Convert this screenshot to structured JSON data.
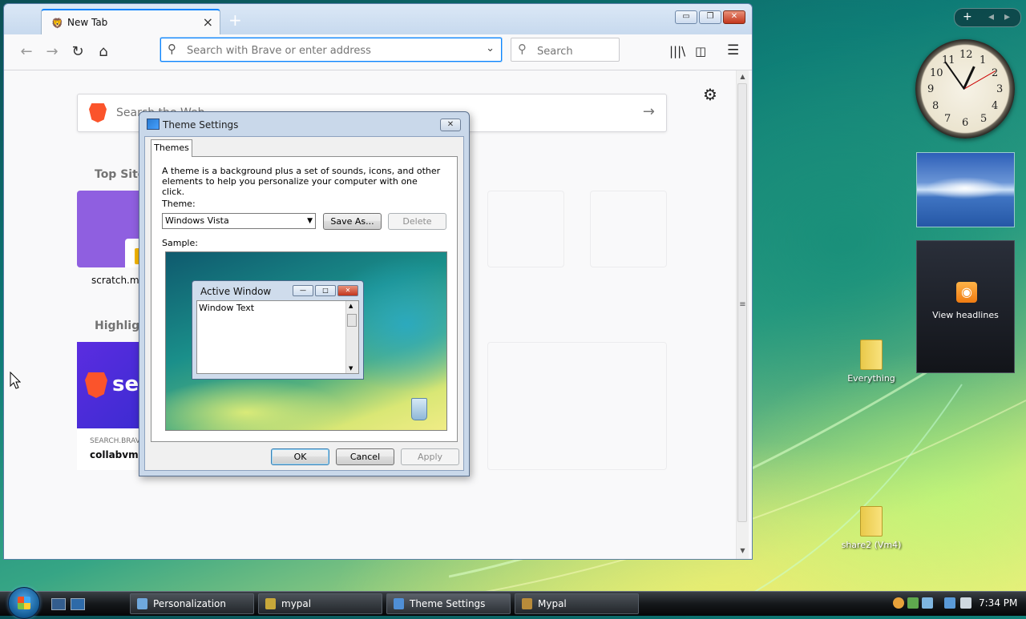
{
  "browser": {
    "tab": {
      "title": "New Tab",
      "close": "×"
    },
    "new_tab": "+",
    "window_controls": {
      "minimize": "▭",
      "maximize": "❐",
      "close": "✕"
    },
    "nav": {
      "back": "←",
      "forward": "→",
      "reload": "↻",
      "home": "⌂"
    },
    "urlbar": {
      "placeholder": "Search with Brave or enter address",
      "dropdown": "⌄"
    },
    "searchbox": {
      "placeholder": "Search"
    },
    "toolbar_icons": {
      "library": "|||\\",
      "sidebar": "◫",
      "menu": "☰"
    },
    "content": {
      "settings_icon": "⚙",
      "web_search": {
        "placeholder": "Search the Web",
        "go": "→"
      },
      "top_sites_heading": "Top Sites",
      "top_site_label": "scratch.mit",
      "highlights_heading": "Highlight",
      "highlight_card": {
        "brand": "se",
        "source": "SEARCH.BRAV",
        "title": "collabvm -"
      }
    },
    "scroll": {
      "up": "▲",
      "down": "▼",
      "grip": "≡"
    }
  },
  "dialog": {
    "title": "Theme Settings",
    "close": "✕",
    "tab": "Themes",
    "description": "A theme is a background plus a set of sounds, icons, and other elements to help you personalize your computer with one click.",
    "theme_label": "Theme:",
    "theme_value": "Windows Vista",
    "save_as": "Save As...",
    "delete": "Delete",
    "sample_label": "Sample:",
    "sample": {
      "window_title": "Active Window",
      "window_text": "Window Text",
      "controls": {
        "min": "—",
        "max": "□",
        "close": "✕"
      },
      "scroll_up": "▲",
      "scroll_down": "▼"
    },
    "ok": "OK",
    "cancel": "Cancel",
    "apply": "Apply"
  },
  "sidebar": {
    "add": "+",
    "prev": "◂",
    "next": "▸",
    "clock_numbers": [
      "12",
      "1",
      "2",
      "3",
      "4",
      "5",
      "6",
      "7",
      "8",
      "9",
      "10",
      "11"
    ],
    "feed_label": "View headlines",
    "rss_glyph": "◉"
  },
  "desktop_icons": [
    {
      "label": "Everything"
    },
    {
      "label": "share2 (Vm4)"
    }
  ],
  "taskbar": {
    "tasks": [
      {
        "label": "Personalization",
        "color": "#6fa8dc"
      },
      {
        "label": "mypal",
        "color": "#c8a83a"
      },
      {
        "label": "Theme Settings",
        "color": "#4f8fd6"
      },
      {
        "label": "Mypal",
        "color": "#b88b3a"
      }
    ],
    "time": "7:34 PM"
  }
}
